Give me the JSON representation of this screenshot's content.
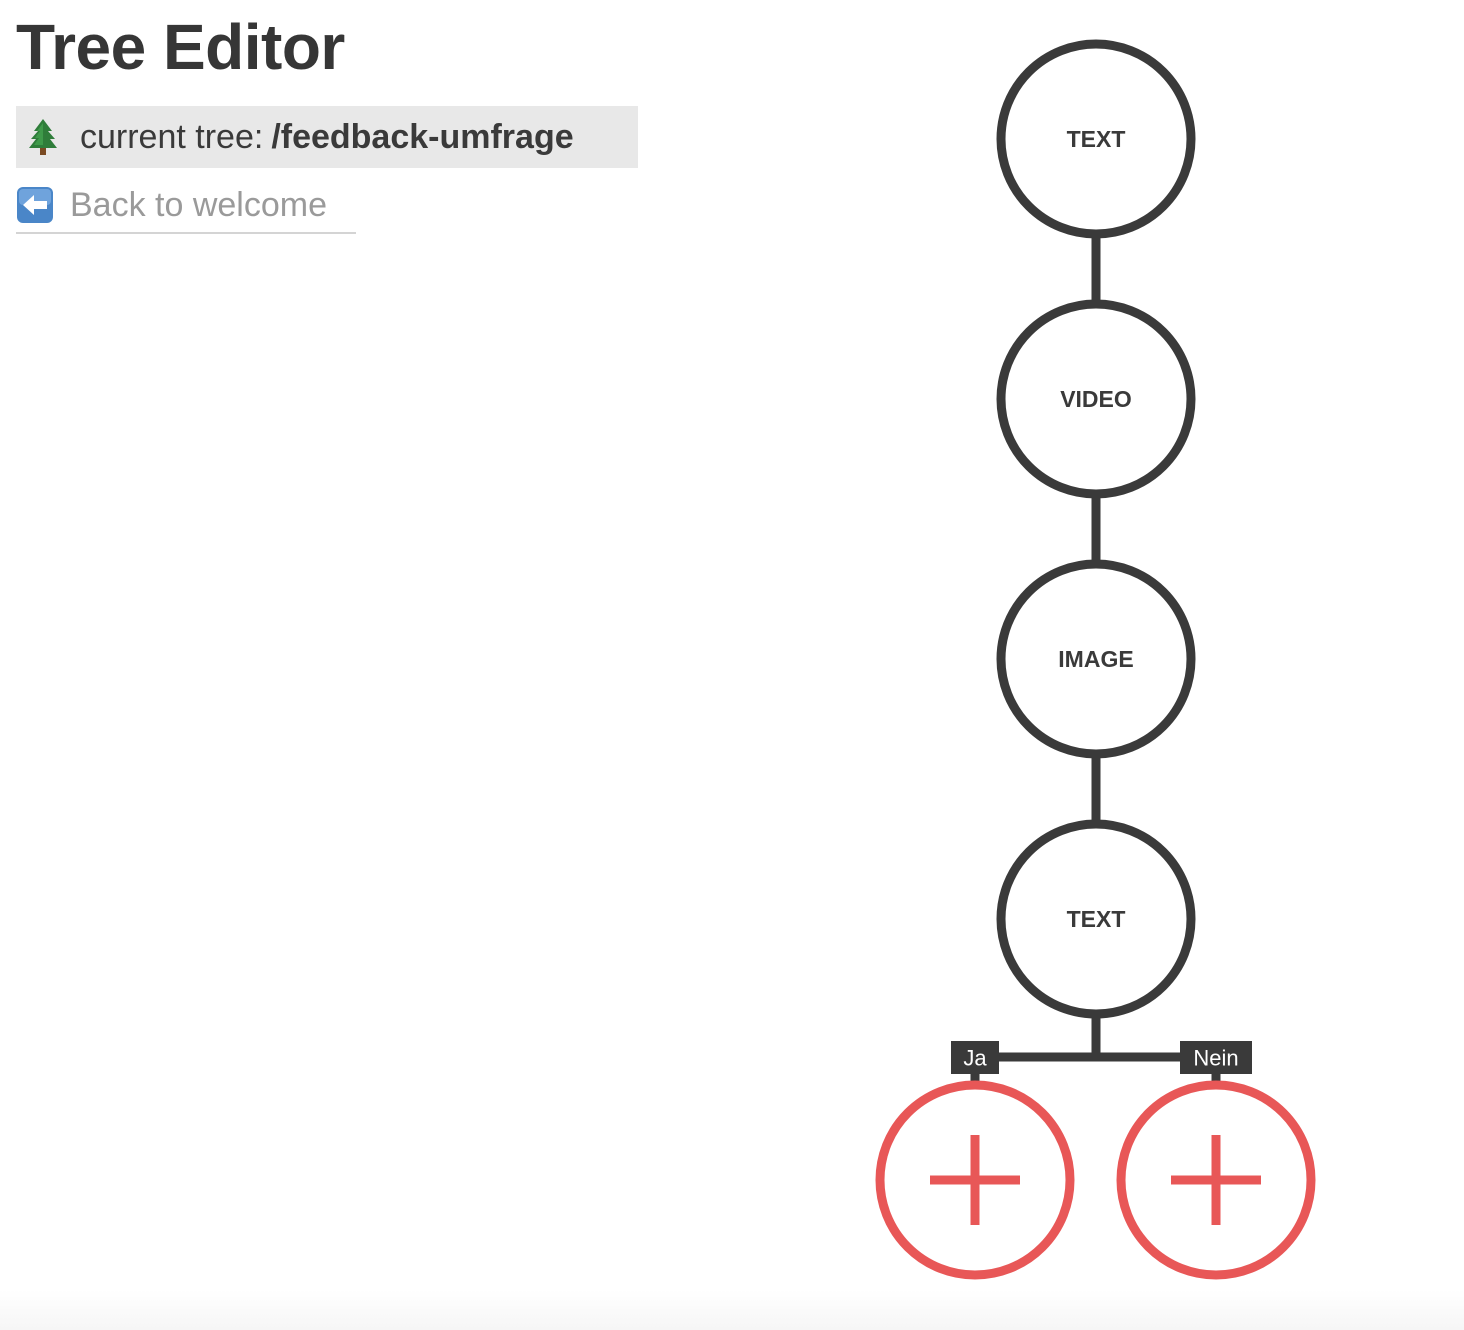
{
  "header": {
    "title": "Tree Editor"
  },
  "current_tree": {
    "icon": "evergreen-tree-icon",
    "prefix": "current tree:",
    "name": "/feedback-umfrage"
  },
  "back_link": {
    "icon": "back-arrow-icon",
    "label": "Back to welcome"
  },
  "tree": {
    "nodes": [
      {
        "label": "TEXT"
      },
      {
        "label": "VIDEO"
      },
      {
        "label": "IMAGE"
      },
      {
        "label": "TEXT"
      }
    ],
    "branches": [
      {
        "label": "Ja",
        "action": "add-node"
      },
      {
        "label": "Nein",
        "action": "add-node"
      }
    ]
  },
  "colors": {
    "node_stroke": "#3a3a3a",
    "add_accent": "#e85757",
    "tree_bar_bg": "#e8e8e8",
    "link_text": "#9a9a9a"
  }
}
